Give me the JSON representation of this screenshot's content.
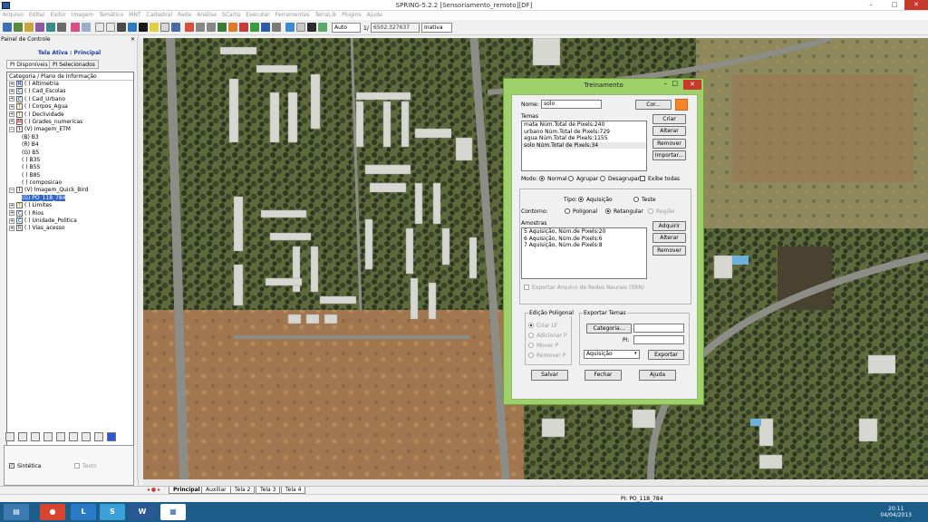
{
  "window": {
    "title": "SPRING-5.2.2 [Sensoriamento_remoto][DF]",
    "min_glyph": "–",
    "max_glyph": "□",
    "close_glyph": "✕"
  },
  "menu": [
    "Arquivo",
    "Editar",
    "Exibir",
    "Imagem",
    "Temático",
    "MNT",
    "Cadastral",
    "Rede",
    "Análise",
    "SCarta",
    "Executar",
    "Ferramentas",
    "TerraLib",
    "Plugins",
    "Ajuda"
  ],
  "toolbar": {
    "zoom_mode": "Auto",
    "scale_prefix": "1/",
    "scale_value": "6502.327637",
    "status_select": "Inativa"
  },
  "left_panel": {
    "header": "Painel de Controle",
    "close_glyph": "✕",
    "active_screen": "Tela Ativa : Principal",
    "tab_available": "PI Disponíveis",
    "tab_selected": "PI Selecionados",
    "tree_header": "Categoria / Plano de Informação",
    "tree": [
      {
        "expander": "+",
        "cat": "N",
        "label": "( ) Altimetria",
        "indent": 0
      },
      {
        "expander": "+",
        "cat": "C",
        "label": "( ) Cad_Escolas",
        "indent": 0
      },
      {
        "expander": "+",
        "cat": "C",
        "label": "( ) Cad_Urbano",
        "indent": 0
      },
      {
        "expander": "+",
        "cat": "T",
        "label": "( ) Corpos_Agua",
        "indent": 0
      },
      {
        "expander": "+",
        "cat": "T",
        "label": "( ) Declividade",
        "indent": 0
      },
      {
        "expander": "+",
        "cat": "M",
        "label": "( ) Grades_numericas",
        "indent": 0
      },
      {
        "expander": "−",
        "cat": "I",
        "label": "(V) Imagem_ETM",
        "indent": 0
      },
      {
        "expander": "",
        "cat": "",
        "label": "(B) B3",
        "indent": 1
      },
      {
        "expander": "",
        "cat": "",
        "label": "(R) B4",
        "indent": 1
      },
      {
        "expander": "",
        "cat": "",
        "label": "(G) B5",
        "indent": 1
      },
      {
        "expander": "",
        "cat": "",
        "label": "( ) B3S",
        "indent": 1
      },
      {
        "expander": "",
        "cat": "",
        "label": "( ) B5S",
        "indent": 1
      },
      {
        "expander": "",
        "cat": "",
        "label": "( ) B8S",
        "indent": 1
      },
      {
        "expander": "",
        "cat": "",
        "label": "( ) composicao",
        "indent": 1
      },
      {
        "expander": "−",
        "cat": "I",
        "label": "(V) Imagem_Quick_Bird",
        "indent": 0
      },
      {
        "expander": "",
        "cat": "",
        "label": "(G) PO_118_784",
        "indent": 1,
        "selected": true
      },
      {
        "expander": "+",
        "cat": "T",
        "label": "( ) Limites",
        "indent": 0
      },
      {
        "expander": "+",
        "cat": "C",
        "label": "( ) Rios",
        "indent": 0
      },
      {
        "expander": "+",
        "cat": "C",
        "label": "( ) Unidade_Politica",
        "indent": 0
      },
      {
        "expander": "+",
        "cat": "R",
        "label": "( ) Vias_acesso",
        "indent": 0
      }
    ],
    "chk_synthetic": "Sintética",
    "chk_text": "Texto"
  },
  "bottom_tabs": [
    "Principal",
    "Auxiliar",
    "Tela 2",
    "Tela 3",
    "Tela 4"
  ],
  "status": {
    "pi": "PI: PO_118_784"
  },
  "taskbar": {
    "time": "20:11",
    "date": "04/04/2013"
  },
  "dialog": {
    "title": "Treinamento",
    "name_label": "Nome:",
    "name_value": "solo",
    "color_button": "Cor...",
    "color": "#f7842b",
    "themes_label": "Temas",
    "themes": [
      "mata    Núm.Total de Pixels:240",
      "urbano  Núm.Total de Pixels:729",
      "agua    Núm.Total de Pixels:1155",
      "solo    Núm.Total de Pixels:34"
    ],
    "btn_create": "Criar",
    "btn_alter": "Alterar",
    "btn_remove": "Remover",
    "btn_import": "Importar...",
    "mode_label": "Modo:",
    "mode_normal": "Normal",
    "mode_group": "Agrupar",
    "mode_ungroup": "Desagrupar",
    "mode_show_all": "Exibe todas",
    "type_label": "Tipo:",
    "type_acquisition": "Aquisição",
    "type_test": "Teste",
    "contour_label": "Contorno:",
    "contour_polygonal": "Poligonal",
    "contour_rect": "Retangular",
    "contour_region": "Região",
    "samples_label": "Amostras",
    "samples": [
      "5 Aquisição,   Núm.de Pixels:20",
      "6 Aquisição,   Núm.de Pixels:6",
      "7 Aquisição,   Núm.de Pixels:8"
    ],
    "btn_add": "Adquirir",
    "btn_alter2": "Alterar",
    "btn_remove2": "Remover",
    "export_rn": "Exportar Arquivo de Redes Neurais (SRN)",
    "poly_edit_label": "Edição Poligonal",
    "poly_create": "Criar LF",
    "poly_add": "Adicionar P",
    "poly_move": "Mover P",
    "poly_remove": "Remover P",
    "export_themes_label": "Exportar Temas",
    "btn_category": "Categoria...",
    "pi_label": "PI:",
    "export_select": "Aquisição",
    "btn_export": "Exportar",
    "btn_save": "Salvar",
    "btn_close": "Fechar",
    "btn_help": "Ajuda"
  }
}
